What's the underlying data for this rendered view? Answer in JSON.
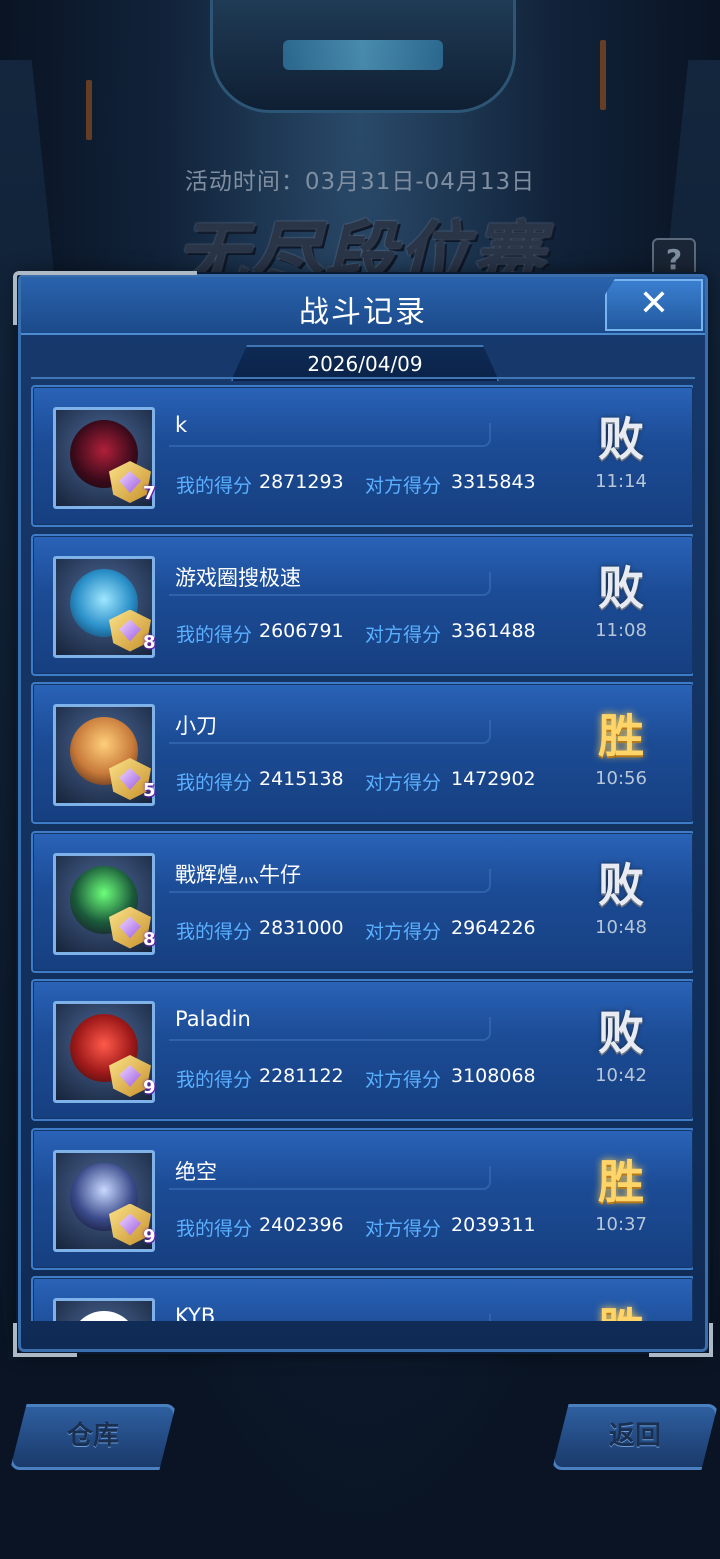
{
  "event": {
    "time": "活动时间：03月31日-04月13日",
    "title": "无尽段位赛",
    "help": "?"
  },
  "modal": {
    "title": "战斗记录",
    "close": "✕",
    "date": "2026/04/09",
    "labels": {
      "my_score": "我的得分",
      "opp_score": "对方得分"
    }
  },
  "records": [
    {
      "name": "k",
      "my_score": "2871293",
      "opp_score": "3315843",
      "result": "败",
      "time": "11:14",
      "rank_level": "7"
    },
    {
      "name": "游戏圈搜极速",
      "my_score": "2606791",
      "opp_score": "3361488",
      "result": "败",
      "time": "11:08",
      "rank_level": "8"
    },
    {
      "name": "小刀",
      "my_score": "2415138",
      "opp_score": "1472902",
      "result": "胜",
      "time": "10:56",
      "rank_level": "5"
    },
    {
      "name": "戰辉煌灬牛仔",
      "my_score": "2831000",
      "opp_score": "2964226",
      "result": "败",
      "time": "10:48",
      "rank_level": "8"
    },
    {
      "name": "Paladin",
      "my_score": "2281122",
      "opp_score": "3108068",
      "result": "败",
      "time": "10:42",
      "rank_level": "9"
    },
    {
      "name": "绝空",
      "my_score": "2402396",
      "opp_score": "2039311",
      "result": "胜",
      "time": "10:37",
      "rank_level": "9"
    },
    {
      "name": "KYB",
      "my_score": "",
      "opp_score": "",
      "result": "胜",
      "time": "",
      "rank_level": ""
    }
  ],
  "bottom": {
    "left": "仓库",
    "right": "返回"
  },
  "colors": {
    "win": "#ffd56a",
    "lose": "#e8ecf2",
    "label": "#5ab0ff",
    "panel": "#16386b"
  }
}
